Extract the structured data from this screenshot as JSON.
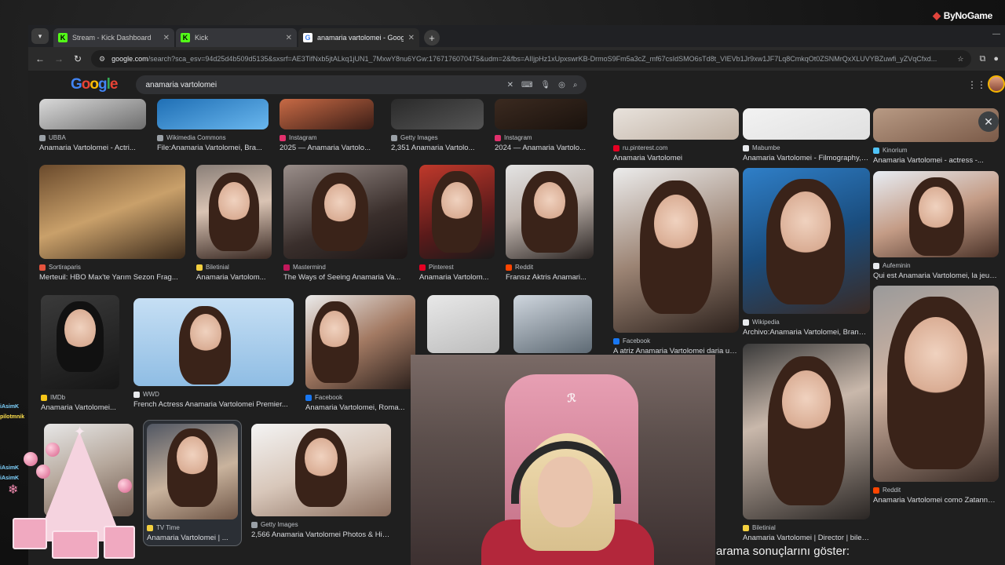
{
  "stream_logo": "ByNoGame",
  "tabs": [
    {
      "label": "Stream - Kick Dashboard",
      "icon": "kick-icon",
      "active": false
    },
    {
      "label": "Kick",
      "icon": "kick-icon",
      "active": false
    },
    {
      "label": "anamaria vartolomei - Google'd",
      "icon": "google-icon",
      "active": true
    }
  ],
  "address": {
    "domain": "google.com",
    "path": "/search?sca_esv=94d25d4b509d5135&sxsrf=AE3TifNxb5jtALkq1jUN1_7MxwY8nu6YGw:1767176070475&udm=2&fbs=AIIjpHz1xUpxswrKB-DrmoS9Fm5a3cZ_mf67csIdSMO6sTd8t_VIEVb1Jr9xw1JF7Lq8CmkqOt0ZSNMrQxXLUVYBZuwfi_yZVqCfxd..."
  },
  "google": {
    "query": "anamaria vartolomei"
  },
  "results": [
    {
      "source": "UBBA",
      "caption": "Anamaria Vartolomei - Actri...",
      "src_color": "#9aa0a6"
    },
    {
      "source": "Wikimedia Commons",
      "caption": "File:Anamaria Vartolomei, Bra...",
      "src_color": "#9aa0a6"
    },
    {
      "source": "Instagram",
      "caption": "2025 — Anamaria Vartolo...",
      "src_color": "#e1306c"
    },
    {
      "source": "Getty Images",
      "caption": "2,351 Anamaria Vartolo...",
      "src_color": "#9aa0a6"
    },
    {
      "source": "Instagram",
      "caption": "2024 — Anamaria Vartolo...",
      "src_color": "#e1306c"
    },
    {
      "source": "Sortiraparis",
      "caption": "Merteuil: HBO Max'te Yarım Sezon Frag...",
      "src_color": "#e5533d"
    },
    {
      "source": "Biletinial",
      "caption": "Anamaria Vartolom...",
      "src_color": "#f4d03f"
    },
    {
      "source": "Mastermind",
      "caption": "The Ways of Seeing Anamaria Va...",
      "src_color": "#c2185b"
    },
    {
      "source": "Pinterest",
      "caption": "Anamaria Vartolom...",
      "src_color": "#e60023"
    },
    {
      "source": "Reddit",
      "caption": "Fransız Aktris Anamari...",
      "src_color": "#ff4500"
    },
    {
      "source": "IMDb",
      "caption": "Anamaria Vartolomei...",
      "src_color": "#f5c518"
    },
    {
      "source": "WWD",
      "caption": "French Actress Anamaria Vartolomei Premier...",
      "src_color": "#e8eaed"
    },
    {
      "source": "Facebook",
      "caption": "Anamaria Vartolomei, Roma...",
      "src_color": "#1877f2"
    },
    {
      "source": "TV Time",
      "caption": "Anamaria Vartolomei | ...",
      "src_color": "#f4d03f"
    },
    {
      "source": "Getty Images",
      "caption": "2,566 Anamaria Vartolomei Photos & Hig...",
      "src_color": "#9aa0a6"
    },
    {
      "source": "ru.pinterest.com",
      "caption": "Anamaria Vartolomei",
      "src_color": "#e60023"
    },
    {
      "source": "Mabumbe",
      "caption": "Anamaria Vartolomei - Filmography, Ag...",
      "src_color": "#e8eaed"
    },
    {
      "source": "Kinorium",
      "caption": "Anamaria Vartolomei - actress -...",
      "src_color": "#4fc3f7"
    },
    {
      "source": "Facebook",
      "caption": "A atriz Anamaria Vartolomei daria uma...",
      "src_color": "#1877f2"
    },
    {
      "source": "Wikipedia",
      "caption": "Archivo:Anamaria Vartolomei, Brandon...",
      "src_color": "#e8eaed"
    },
    {
      "source": "Aufeminin",
      "caption": "Qui est Anamaria Vartolomei, la jeune...",
      "src_color": "#e8eaed"
    },
    {
      "source": "Reddit",
      "caption": "Anamaria Vartolomei como Zatanna da...",
      "src_color": "#ff4500"
    },
    {
      "source": "Biletinial",
      "caption": "Anamaria Vartolomei | Director | biletinial",
      "src_color": "#f4d03f"
    }
  ],
  "chat_names": [
    {
      "text": "iAsimK",
      "color": "#7fd3ff"
    },
    {
      "text": "pilotmnik",
      "color": "#ffe14d"
    },
    {
      "text": "iAsimK",
      "color": "#7fd3ff"
    },
    {
      "text": "iAsimK",
      "color": "#7fd3ff"
    }
  ],
  "stream_caption": "arama sonuçlarını göster:",
  "colors": {
    "accent": "#8ab4f8",
    "kick_green": "#53fc18",
    "chair_pink": "#e79fb3"
  }
}
